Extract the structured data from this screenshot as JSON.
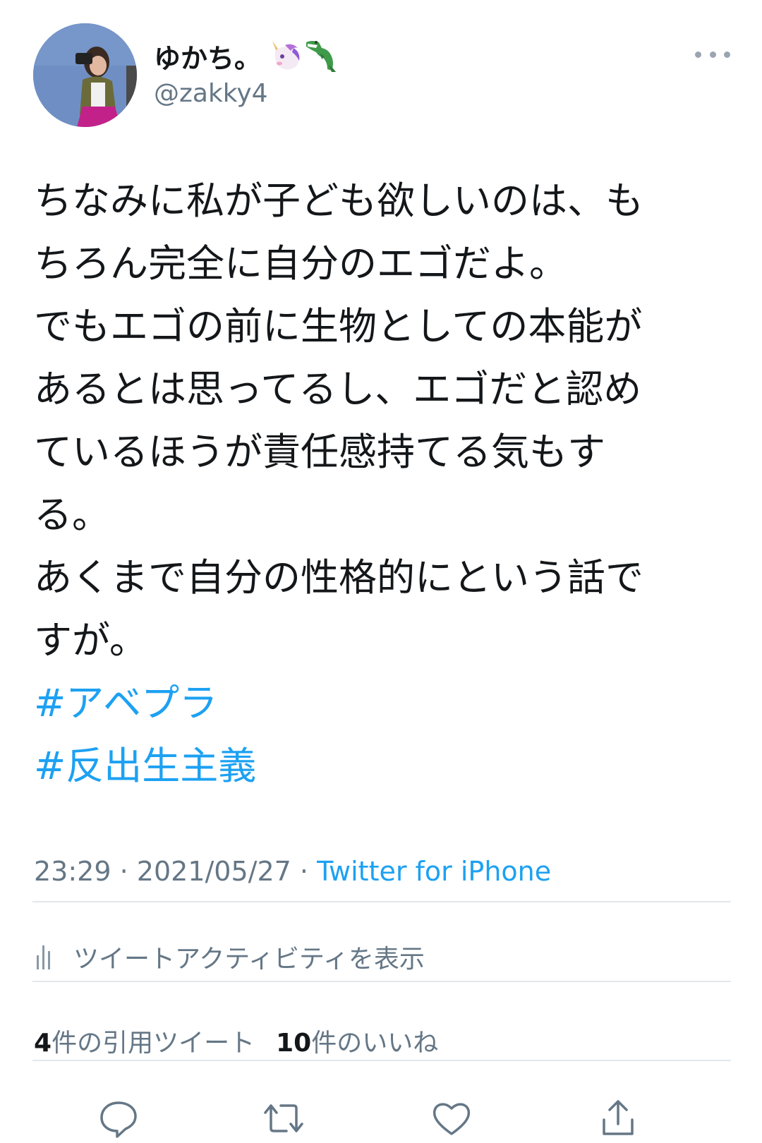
{
  "user": {
    "display_name": "ゆかち。",
    "name_emojis": [
      "unicorn-emoji",
      "crocodile-emoji"
    ],
    "handle": "@zakky4"
  },
  "tweet": {
    "lines": [
      "ちなみに私が子ども欲しいのは、も",
      "ちろん完全に自分のエゴだよ。",
      "でもエゴの前に生物としての本能が",
      "あるとは思ってるし、エゴだと認め",
      "ているほうが責任感持てる気もす",
      "る。",
      "あくまで自分の性格的にという話で",
      "すが。"
    ],
    "hashtags": [
      "#アベプラ",
      "#反出生主義"
    ]
  },
  "meta": {
    "time": "23:29",
    "separator": "·",
    "date": "2021/05/27",
    "source": "Twitter for iPhone"
  },
  "activity": {
    "label": "ツイートアクティビティを表示",
    "icon": "activity-chart-icon"
  },
  "stats": {
    "quote_count": "4",
    "quote_label": "件の引用ツイート",
    "like_count": "10",
    "like_label": "件のいいね"
  },
  "actions": [
    "reply-icon",
    "retweet-icon",
    "like-icon",
    "share-icon"
  ],
  "colors": {
    "link": "#1da1f2",
    "secondary_text": "#657786",
    "primary_text": "#14171a",
    "divider": "#e1e8ed"
  }
}
